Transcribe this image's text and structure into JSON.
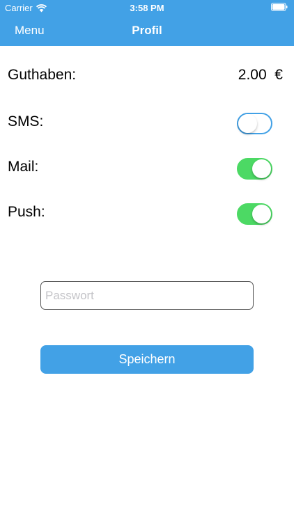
{
  "status_bar": {
    "carrier": "Carrier",
    "time": "3:58 PM",
    "wifi_icon": "wifi-icon",
    "battery_icon": "battery-icon"
  },
  "nav": {
    "menu_label": "Menu",
    "title": "Profil"
  },
  "balance": {
    "label": "Guthaben:",
    "value": "2.00  €"
  },
  "settings": {
    "sms": {
      "label": "SMS:",
      "enabled": false
    },
    "mail": {
      "label": "Mail:",
      "enabled": true
    },
    "push": {
      "label": "Push:",
      "enabled": true
    }
  },
  "password": {
    "value": "",
    "placeholder": "Passwort"
  },
  "save_label": "Speichern",
  "colors": {
    "accent": "#42a1e6",
    "toggle_on": "#4cd964"
  }
}
